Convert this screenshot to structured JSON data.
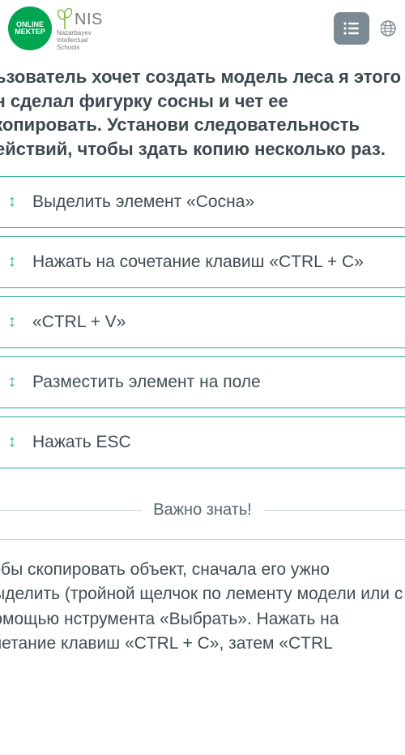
{
  "header": {
    "logo_line1": "ONLINE",
    "logo_line2": "MEKTEP",
    "nis_label": "NIS",
    "nis_sub1": "Nazarbayev",
    "nis_sub2": "Intellectual",
    "nis_sub3": "Schools"
  },
  "question_text": "льзователь хочет создать модель леса я этого он сделал фигурку сосны и чет ее скопировать. Установи следовательность действий, чтобы здать копию несколько раз.",
  "options": [
    {
      "text": "Выделить элемент «Сосна»"
    },
    {
      "text": "Нажать на сочетание клавиш «CTRL + C»"
    },
    {
      "text": "«CTRL + V»"
    },
    {
      "text": "Разместить элемент на поле"
    },
    {
      "text": "Нажать ESC"
    }
  ],
  "divider_label": "Важно знать!",
  "info_text": "тобы скопировать объект, сначала его ужно выделить (тройной щелчок по лементу модели или с помощью нструмента «Выбрать». Нажать на очетание клавиш «CTRL + C», затем «CTRL"
}
